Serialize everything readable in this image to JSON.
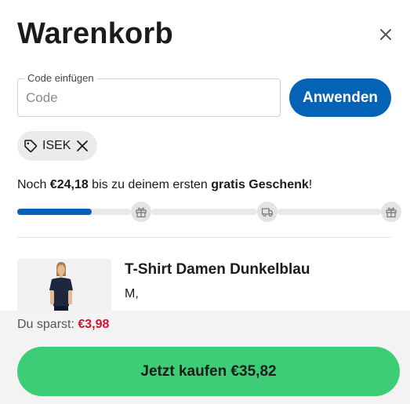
{
  "header": {
    "title": "Warenkorb",
    "close_icon": "close-icon"
  },
  "coupon_form": {
    "label": "Code einfügen",
    "value": "",
    "placeholder": "Code",
    "apply_label": "Anwenden",
    "apply_color": "#0563b6"
  },
  "applied_coupon": {
    "code": "ISEK",
    "icon": "tag-icon",
    "remove_icon": "x-icon"
  },
  "gift_progress": {
    "prefix": "Noch ",
    "amount": "€24,18",
    "middle": " bis zu deinem ersten ",
    "emphasis": "gratis Geschenk",
    "suffix": "!",
    "progress_fraction": 0.2,
    "milestones": [
      {
        "icon": "gift-icon",
        "kind": "gift"
      },
      {
        "icon": "delivery-truck-icon",
        "kind": "free-shipping"
      },
      {
        "icon": "gift-icon",
        "kind": "gift"
      }
    ],
    "fill_color": "#0563b6"
  },
  "cart_items": [
    {
      "name": "T-Shirt Damen Dunkelblau",
      "variant": "M,",
      "image": "woman-in-dark-blue-tshirt"
    }
  ],
  "footer": {
    "savings_label": "Du sparst: ",
    "savings_amount": "€3,98",
    "savings_color": "#d1112e",
    "checkout_label": "Jetzt kaufen €35,82",
    "checkout_color": "#3dcd76"
  }
}
